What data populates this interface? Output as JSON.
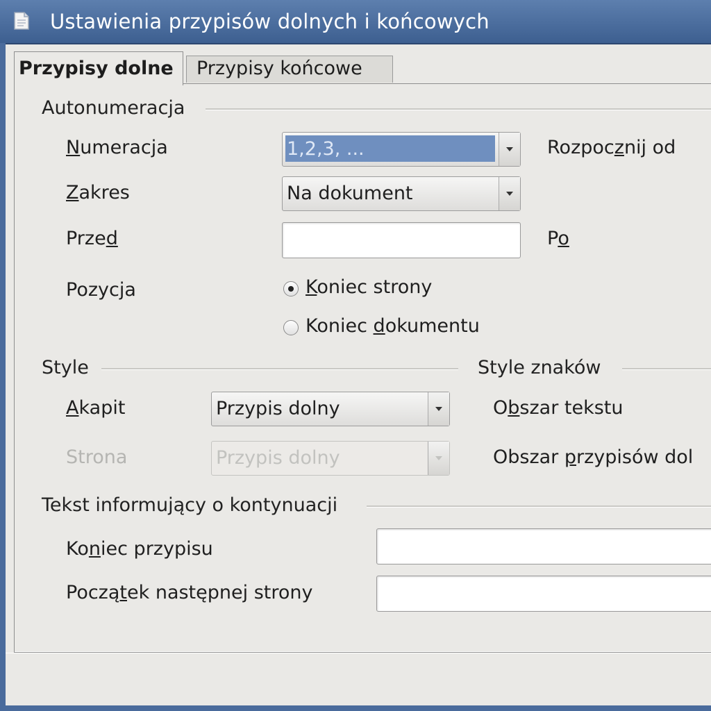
{
  "window": {
    "title": "Ustawienia przypisów dolnych i końcowych",
    "icon": "document-icon"
  },
  "tabs": [
    {
      "label": "Przypisy dolne",
      "active": true
    },
    {
      "label": "Przypisy końcowe",
      "active": false
    }
  ],
  "autonumbering": {
    "group_title": "Autonumeracja",
    "numbering": {
      "label_pre": "",
      "label_u": "N",
      "label_post": "umeracja",
      "value": "1,2,3, ..."
    },
    "start_at": {
      "label_pre": "Rozpoc",
      "label_u": "z",
      "label_post": "nij od"
    },
    "scope": {
      "label_pre": "",
      "label_u": "Z",
      "label_post": "akres",
      "value": "Na dokument"
    },
    "before": {
      "label_pre": "Prze",
      "label_u": "d",
      "label_post": "",
      "value": ""
    },
    "after": {
      "label_pre": "P",
      "label_u": "o",
      "label_post": ""
    },
    "position": {
      "label": "Pozycja",
      "options": [
        {
          "label_pre": "",
          "label_u": "K",
          "label_post": "oniec strony",
          "checked": true
        },
        {
          "label_pre": "Koniec ",
          "label_u": "d",
          "label_post": "okumentu",
          "checked": false
        }
      ]
    }
  },
  "styles": {
    "group_title": "Style",
    "paragraph": {
      "label_pre": "",
      "label_u": "A",
      "label_post": "kapit",
      "value": "Przypis dolny"
    },
    "page": {
      "label": "Strona",
      "value": "Przypis dolny",
      "disabled": true
    }
  },
  "char_styles": {
    "group_title": "Style znaków",
    "text_area": {
      "label_pre": "O",
      "label_u": "b",
      "label_post": "szar tekstu"
    },
    "footnote_area": {
      "label_pre": "Obszar ",
      "label_u": "p",
      "label_post": "rzypisów dol"
    }
  },
  "continuation": {
    "group_title": "Tekst informujący o kontynuacji",
    "end_of_footnote": {
      "label_pre": "Ko",
      "label_u": "n",
      "label_post": "iec przypisu",
      "value": ""
    },
    "start_of_next_page": {
      "label_pre": "Począ",
      "label_u": "t",
      "label_post": "ek następnej strony",
      "value": ""
    }
  },
  "colors": {
    "titlebar": "#4a6b9c",
    "selection": "#6f8fbf",
    "dialog_bg": "#eae9e6"
  }
}
